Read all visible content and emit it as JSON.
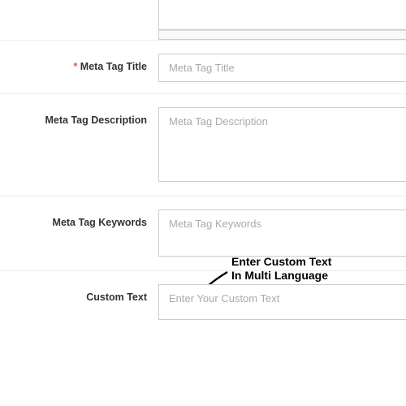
{
  "fields": {
    "meta_title": {
      "label": "Meta Tag Title",
      "required_mark": "*",
      "placeholder": "Meta Tag Title"
    },
    "meta_description": {
      "label": "Meta Tag Description",
      "placeholder": "Meta Tag Description"
    },
    "meta_keywords": {
      "label": "Meta Tag Keywords",
      "placeholder": "Meta Tag Keywords"
    },
    "custom_text": {
      "label": "Custom Text",
      "placeholder": "Enter Your Custom Text"
    }
  },
  "annotation": {
    "line1": "Enter Custom Text",
    "line2": "In Multi Language"
  }
}
